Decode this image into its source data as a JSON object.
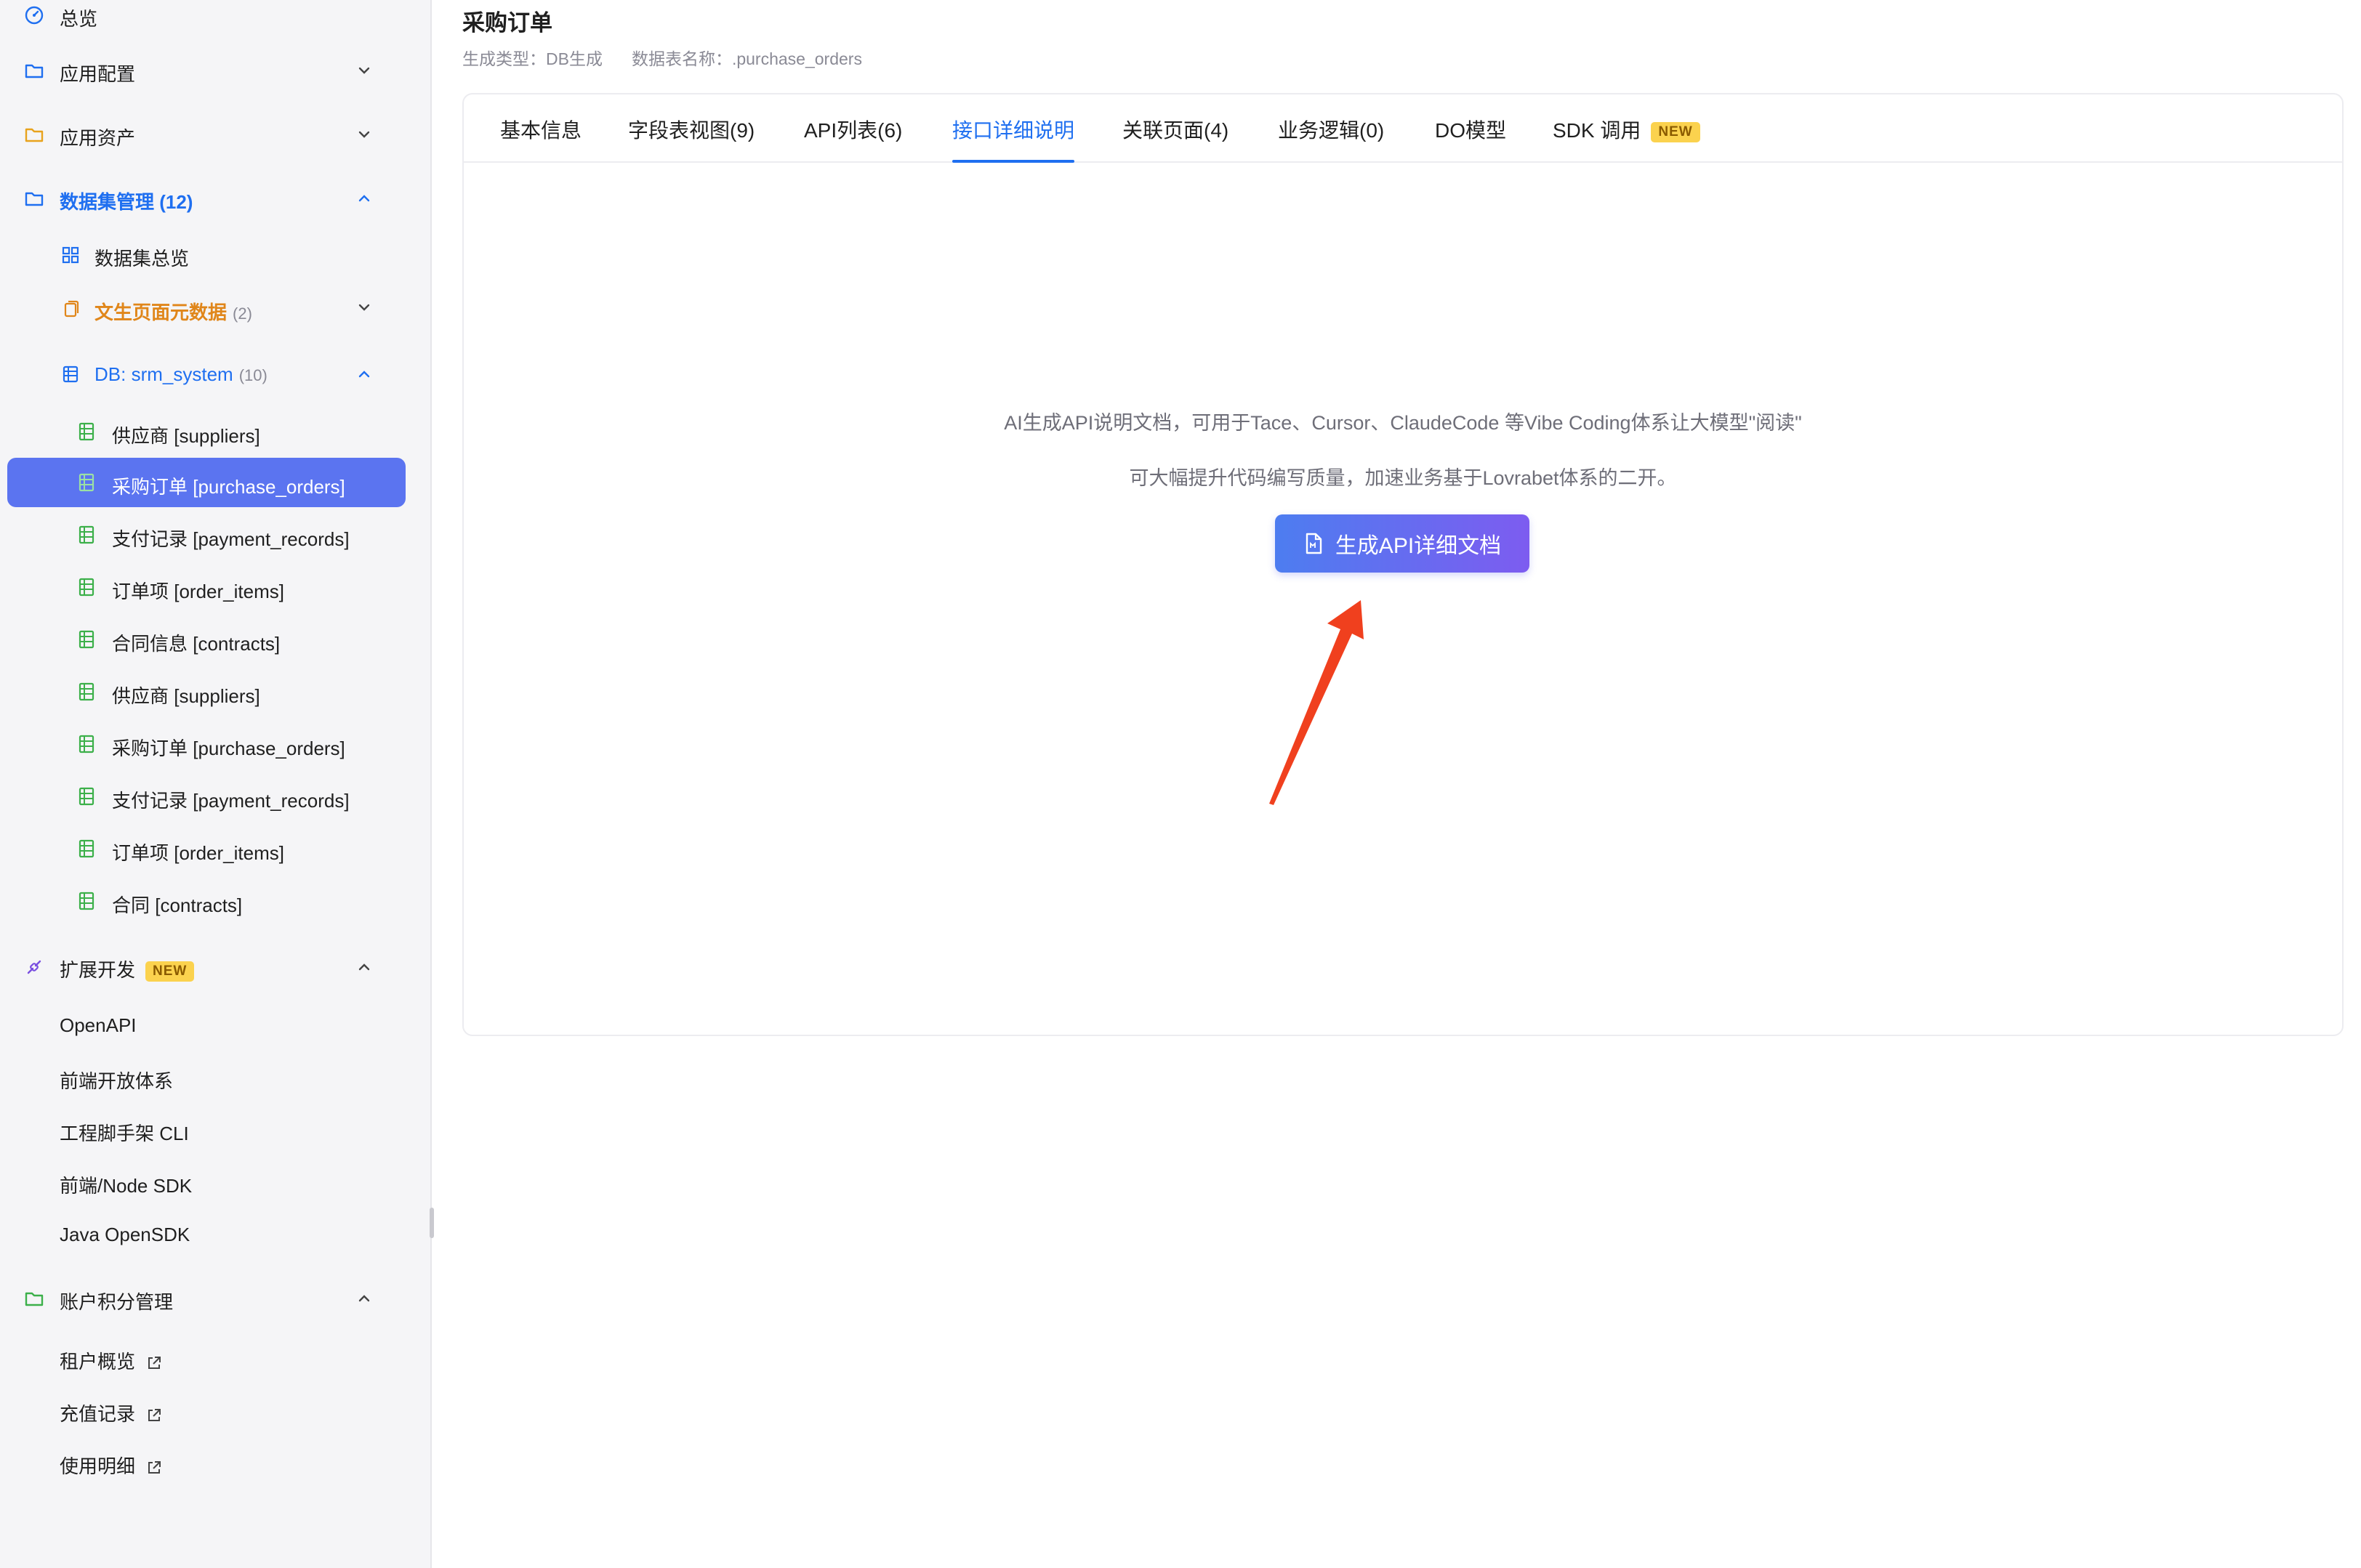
{
  "sidebar": {
    "overview": "总览",
    "app_config": "应用配置",
    "app_assets": "应用资产",
    "dataset_mgmt": "数据集管理 (12)",
    "dataset_overview": "数据集总览",
    "text_page_meta": "文生页面元数据",
    "text_page_meta_count": "(2)",
    "db_group": "DB: srm_system",
    "db_group_count": "(10)",
    "tables": [
      "供应商 [suppliers]",
      "采购订单 [purchase_orders]",
      "支付记录 [payment_records]",
      "订单项 [order_items]",
      "合同信息 [contracts]",
      "供应商 [suppliers]",
      "采购订单 [purchase_orders]",
      "支付记录 [payment_records]",
      "订单项 [order_items]",
      "合同 [contracts]"
    ],
    "ext_dev": "扩展开发",
    "ext_badge": "NEW",
    "ext_items": [
      "OpenAPI",
      "前端开放体系",
      "工程脚手架 CLI",
      "前端/Node SDK",
      "Java OpenSDK"
    ],
    "account": "账户积分管理",
    "account_items": [
      "租户概览",
      "充值记录",
      "使用明细"
    ]
  },
  "header": {
    "title": "采购订单",
    "gen_type": "生成类型：DB生成",
    "table_name": "数据表名称：.purchase_orders"
  },
  "tabs": [
    "基本信息",
    "字段表视图(9)",
    "API列表(6)",
    "接口详细说明",
    "关联页面(4)",
    "业务逻辑(0)",
    "DO模型",
    "SDK 调用"
  ],
  "tab_badge": "NEW",
  "content": {
    "desc_line1": "AI生成API说明文档，可用于Tace、Cursor、ClaudeCode 等Vibe Coding体系让大模型\"阅读\"",
    "desc_line2": "可大幅提升代码编写质量，加速业务基于Lovrabet体系的二开。",
    "button_label": "生成API详细文档"
  },
  "colors": {
    "accent": "#1f6ff0",
    "active_item": "#5b74f0",
    "badge": "#fbd24e",
    "arrow": "#f0401e"
  }
}
